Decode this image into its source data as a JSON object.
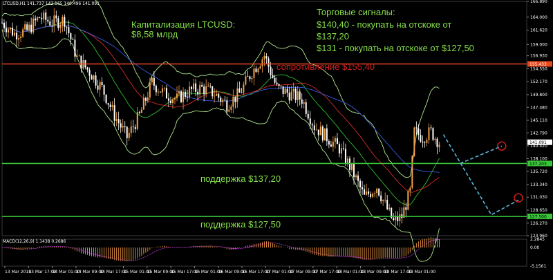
{
  "chart_data": {
    "type": "line",
    "symbol_header": "LTCUSD,H1  141.737 142.165 140.496 141.091",
    "macd_header": "MACD(12,26,9) 1.1438 0.2686",
    "price_axis_ticks": [
      "166.890",
      "164.000",
      "161.620",
      "159.000",
      "156.930",
      "154.550",
      "152.170",
      "149.800",
      "147.480",
      "145.110",
      "142.790",
      "140.420",
      "138.100",
      "135.720",
      "133.340",
      "131.030",
      "128.650",
      "126.270",
      "123.960"
    ],
    "price_axis_range": [
      123.96,
      166.89
    ],
    "current_price_label": "141.091",
    "resistance_level_label": "155.433",
    "support_high_label": "137.203",
    "support_low_label": "127.500",
    "macd_axis_ticks": [
      "2.2845",
      "0.00",
      "-5.1561"
    ],
    "macd_axis_range": [
      -5.1561,
      2.2845
    ],
    "time_axis_ticks": [
      "13 Mar 2018",
      "13 Mar 17:00",
      "14 Mar 01:00",
      "14 Mar 09:00",
      "14 Mar 17:00",
      "15 Mar 01:00",
      "15 Mar 09:00",
      "15 Mar 17:00",
      "16 Mar 01:00",
      "16 Mar 09:00",
      "16 Mar 17:00",
      "17 Mar 01:00",
      "17 Mar 09:00",
      "17 Mar 17:00",
      "18 Mar 01:00",
      "18 Mar 09:00",
      "18 Mar 17:00",
      "19 Mar 01:00"
    ],
    "levels": [
      {
        "label": "сопротивление $155,40",
        "price": 155.43,
        "color": "#e8481e"
      },
      {
        "label": "поддержка $137,20",
        "price": 137.2,
        "color": "#39c43a"
      },
      {
        "label": "поддержка $127,50",
        "price": 127.5,
        "color": "#39c43a"
      }
    ],
    "annotations": {
      "cap_title": "Капитализация LTCUSD:",
      "cap_value": "$8,58 млрд",
      "signals_title": "Торговые сигналы:",
      "signal_1a": "$140,40 - покупать на отскоке от",
      "signal_1b": "$137,20",
      "signal_2": "$131 - покупать на отскоке от $127,50"
    },
    "price_trend": [
      {
        "i": 0,
        "p": 163
      },
      {
        "i": 6,
        "p": 161
      },
      {
        "i": 12,
        "p": 161.5
      },
      {
        "i": 18,
        "p": 164
      },
      {
        "i": 24,
        "p": 163
      },
      {
        "i": 30,
        "p": 163.5
      },
      {
        "i": 36,
        "p": 156.5
      },
      {
        "i": 42,
        "p": 154
      },
      {
        "i": 48,
        "p": 151
      },
      {
        "i": 54,
        "p": 146
      },
      {
        "i": 60,
        "p": 142
      },
      {
        "i": 66,
        "p": 146
      },
      {
        "i": 72,
        "p": 152
      },
      {
        "i": 78,
        "p": 150
      },
      {
        "i": 84,
        "p": 149
      },
      {
        "i": 90,
        "p": 150.5
      },
      {
        "i": 96,
        "p": 151
      },
      {
        "i": 102,
        "p": 150
      },
      {
        "i": 108,
        "p": 148
      },
      {
        "i": 114,
        "p": 150
      },
      {
        "i": 120,
        "p": 154
      },
      {
        "i": 126,
        "p": 157
      },
      {
        "i": 132,
        "p": 151
      },
      {
        "i": 138,
        "p": 150
      },
      {
        "i": 144,
        "p": 149
      },
      {
        "i": 150,
        "p": 144
      },
      {
        "i": 156,
        "p": 142
      },
      {
        "i": 162,
        "p": 140
      },
      {
        "i": 168,
        "p": 136
      },
      {
        "i": 174,
        "p": 131
      },
      {
        "i": 180,
        "p": 133
      },
      {
        "i": 186,
        "p": 128
      },
      {
        "i": 188,
        "p": 126.5
      },
      {
        "i": 192,
        "p": 127.5
      },
      {
        "i": 196,
        "p": 132
      },
      {
        "i": 198,
        "p": 143
      },
      {
        "i": 202,
        "p": 142
      },
      {
        "i": 206,
        "p": 143
      },
      {
        "i": 210,
        "p": 141
      }
    ],
    "forecast": [
      {
        "i": 212,
        "p": 142.5
      },
      {
        "i": 235,
        "p": 127.8
      },
      {
        "i": 248,
        "p": 130.5
      }
    ],
    "forecast_alt": [
      {
        "i": 220,
        "p": 137.2
      },
      {
        "i": 240,
        "p": 140.4
      }
    ],
    "forecast_color": "#5ab7dd",
    "targets": [
      {
        "i": 240,
        "p": 140.4
      },
      {
        "i": 248,
        "p": 130.9
      }
    ],
    "candle_colors": {
      "up": "#f3a24a",
      "down": "#ffffff"
    },
    "colors": {
      "grid": "#1f1f1f",
      "bb": "#b4e890",
      "ma_fast": "#2fbf2f",
      "ma_mid": "#d92a2a",
      "ma_slow": "#3a5adf",
      "macd_hist": "#d98a3a",
      "macd_signal": "#c03ad8"
    },
    "grid": true
  }
}
